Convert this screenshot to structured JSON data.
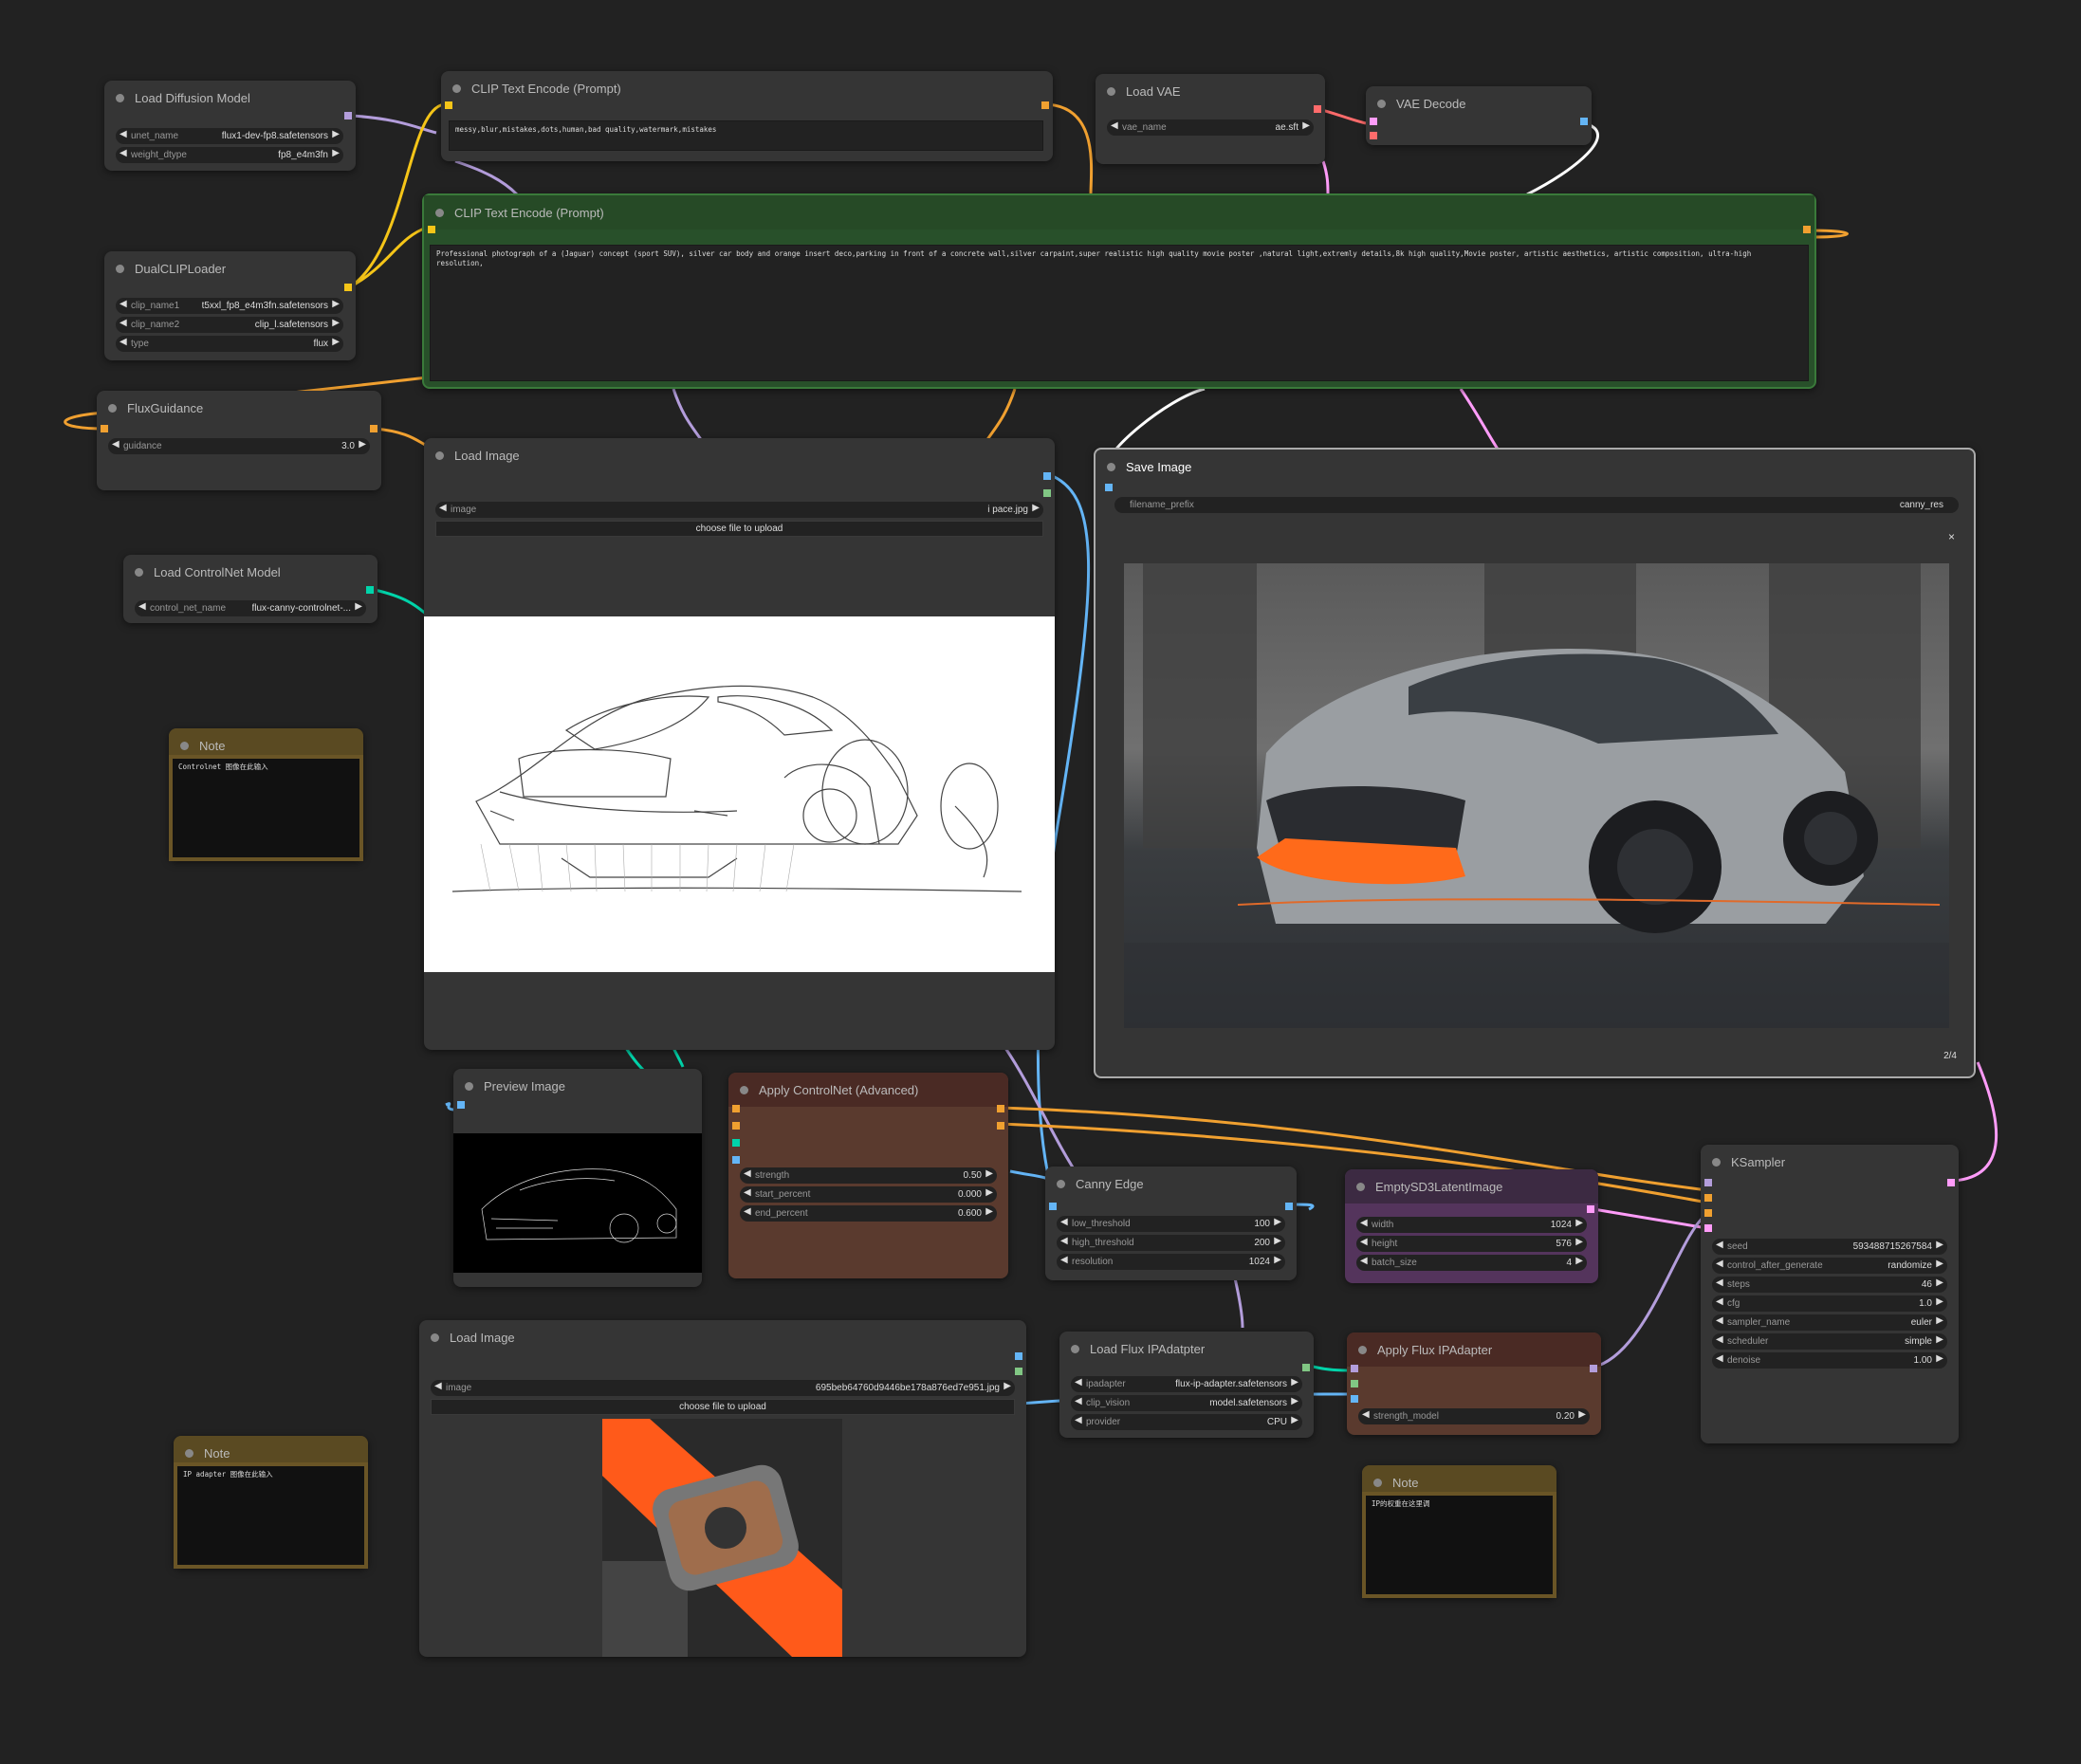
{
  "nodes": {
    "load_diffusion": {
      "title": "Load Diffusion Model",
      "unet_name_label": "unet_name",
      "unet_name": "flux1-dev-fp8.safetensors",
      "weight_dtype_label": "weight_dtype",
      "weight_dtype": "fp8_e4m3fn"
    },
    "dual_clip": {
      "title": "DualCLIPLoader",
      "clip_name1_label": "clip_name1",
      "clip_name1": "t5xxl_fp8_e4m3fn.safetensors",
      "clip_name2_label": "clip_name2",
      "clip_name2": "clip_l.safetensors",
      "type_label": "type",
      "type": "flux"
    },
    "flux_guidance": {
      "title": "FluxGuidance",
      "guidance_label": "guidance",
      "guidance": "3.0"
    },
    "clip_neg": {
      "title": "CLIP Text Encode (Prompt)",
      "text": "messy,blur,mistakes,dots,human,bad quality,watermark,mistakes"
    },
    "clip_pos": {
      "title": "CLIP Text Encode (Prompt)",
      "text": "Professional photograph of a (Jaguar) concept (sport SUV), silver car body and orange insert deco,parking in front of a concrete wall,silver carpaint,super realistic high quality movie poster ,natural light,extremly details,8k high quality,Movie poster,  artistic aesthetics, artistic composition, ultra-high resolution,"
    },
    "load_vae": {
      "title": "Load VAE",
      "vae_name_label": "vae_name",
      "vae_name": "ae.sft"
    },
    "vae_decode": {
      "title": "VAE Decode"
    },
    "load_controlnet": {
      "title": "Load ControlNet Model",
      "name_label": "control_net_name",
      "name": "flux-canny-controlnet-..."
    },
    "note1": {
      "title": "Note",
      "text": "Controlnet 图像在此输入"
    },
    "load_image1": {
      "title": "Load Image",
      "image_label": "image",
      "image": "i pace.jpg",
      "upload": "choose file to upload"
    },
    "save_image": {
      "title": "Save Image",
      "prefix_label": "filename_prefix",
      "prefix": "canny_res",
      "close": "×",
      "counter": "2/4"
    },
    "preview_image": {
      "title": "Preview Image"
    },
    "apply_controlnet": {
      "title": "Apply ControlNet (Advanced)",
      "strength_label": "strength",
      "strength": "0.50",
      "start_label": "start_percent",
      "start": "0.000",
      "end_label": "end_percent",
      "end": "0.600"
    },
    "canny": {
      "title": "Canny Edge",
      "low_label": "low_threshold",
      "low": "100",
      "high_label": "high_threshold",
      "high": "200",
      "res_label": "resolution",
      "res": "1024"
    },
    "empty_latent": {
      "title": "EmptySD3LatentImage",
      "width_label": "width",
      "width": "1024",
      "height_label": "height",
      "height": "576",
      "batch_label": "batch_size",
      "batch": "4"
    },
    "ksampler": {
      "title": "KSampler",
      "seed_label": "seed",
      "seed": "593488715267584",
      "cag_label": "control_after_generate",
      "cag": "randomize",
      "steps_label": "steps",
      "steps": "46",
      "cfg_label": "cfg",
      "cfg": "1.0",
      "sampler_label": "sampler_name",
      "sampler": "euler",
      "scheduler_label": "scheduler",
      "scheduler": "simple",
      "denoise_label": "denoise",
      "denoise": "1.00"
    },
    "load_image2": {
      "title": "Load Image",
      "image_label": "image",
      "image": "695beb64760d9446be178a876ed7e951.jpg",
      "upload": "choose file to upload"
    },
    "note2": {
      "title": "Note",
      "text": "IP adapter 图像在此输入"
    },
    "load_ipadapter": {
      "title": "Load Flux IPAdatpter",
      "ipadapter_label": "ipadapter",
      "ipadapter": "flux-ip-adapter.safetensors",
      "clip_vision_label": "clip_vision",
      "clip_vision": "model.safetensors",
      "provider_label": "provider",
      "provider": "CPU"
    },
    "apply_ipadapter": {
      "title": "Apply Flux IPAdapter",
      "strength_label": "strength_model",
      "strength": "0.20"
    },
    "note3": {
      "title": "Note",
      "text": "IP的权重在这里调"
    }
  },
  "colors": {
    "clip": "#f5c518",
    "model": "#b39ddb",
    "conditioning": "#f0a030",
    "vae": "#ff6b6b",
    "latent": "#ff9cf9",
    "image": "#64b5f6",
    "controlnet": "#00d4aa"
  }
}
